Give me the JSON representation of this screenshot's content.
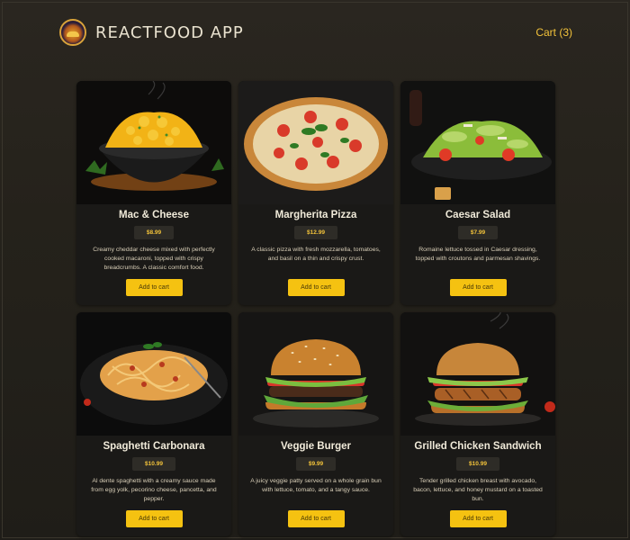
{
  "header": {
    "title": "REACTFOOD APP",
    "cart_label": "Cart (3)"
  },
  "meals": [
    {
      "name": "Mac & Cheese",
      "price": "$8.99",
      "description": "Creamy cheddar cheese mixed with perfectly cooked macaroni, topped with crispy breadcrumbs. A classic comfort food.",
      "button_label": "Add to cart"
    },
    {
      "name": "Margherita Pizza",
      "price": "$12.99",
      "description": "A classic pizza with fresh mozzarella, tomatoes, and basil on a thin and crispy crust.",
      "button_label": "Add to cart"
    },
    {
      "name": "Caesar Salad",
      "price": "$7.99",
      "description": "Romaine lettuce tossed in Caesar dressing, topped with croutons and parmesan shavings.",
      "button_label": "Add to cart"
    },
    {
      "name": "Spaghetti Carbonara",
      "price": "$10.99",
      "description": "Al dente spaghetti with a creamy sauce made from egg yolk, pecorino cheese, pancetta, and pepper.",
      "button_label": "Add to cart"
    },
    {
      "name": "Veggie Burger",
      "price": "$9.99",
      "description": "A juicy veggie patty served on a whole grain bun with lettuce, tomato, and a tangy sauce.",
      "button_label": "Add to cart"
    },
    {
      "name": "Grilled Chicken Sandwich",
      "price": "$10.99",
      "description": "Tender grilled chicken breast with avocado, bacon, lettuce, and honey mustard on a toasted bun.",
      "button_label": "Add to cart"
    }
  ],
  "colors": {
    "accent": "#f5c211",
    "price_text": "#f2c23a",
    "card_bg": "#1a1917",
    "page_bg": "#25221b"
  }
}
